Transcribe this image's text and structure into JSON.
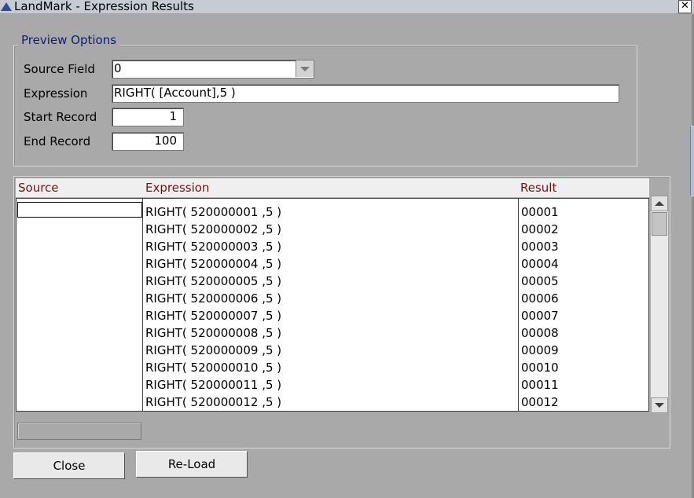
{
  "window": {
    "title": "LandMark - Expression Results",
    "close_glyph": "✕"
  },
  "preview_options": {
    "legend": "Preview Options",
    "source_field_label": "Source Field",
    "source_field_value": "0",
    "expression_label": "Expression",
    "expression_value": "RIGHT( [Account],5 )",
    "start_record_label": "Start Record",
    "start_record_value": "1",
    "end_record_label": "End Record",
    "end_record_value": "100"
  },
  "results_grid": {
    "columns": [
      "Source",
      "Expression",
      "Result"
    ],
    "rows": [
      {
        "source": "",
        "expression": "RIGHT( 520000001 ,5 )",
        "result": "00001"
      },
      {
        "source": "",
        "expression": "RIGHT( 520000002 ,5 )",
        "result": "00002"
      },
      {
        "source": "",
        "expression": "RIGHT( 520000003 ,5 )",
        "result": "00003"
      },
      {
        "source": "",
        "expression": "RIGHT( 520000004 ,5 )",
        "result": "00004"
      },
      {
        "source": "",
        "expression": "RIGHT( 520000005 ,5 )",
        "result": "00005"
      },
      {
        "source": "",
        "expression": "RIGHT( 520000006 ,5 )",
        "result": "00006"
      },
      {
        "source": "",
        "expression": "RIGHT( 520000007 ,5 )",
        "result": "00007"
      },
      {
        "source": "",
        "expression": "RIGHT( 520000008 ,5 )",
        "result": "00008"
      },
      {
        "source": "",
        "expression": "RIGHT( 520000009 ,5 )",
        "result": "00009"
      },
      {
        "source": "",
        "expression": "RIGHT( 520000010 ,5 )",
        "result": "00010"
      },
      {
        "source": "",
        "expression": "RIGHT( 520000011 ,5 )",
        "result": "00011"
      },
      {
        "source": "",
        "expression": "RIGHT( 520000012 ,5 )",
        "result": "00012"
      }
    ]
  },
  "buttons": {
    "close_label": "Close",
    "reload_label": "Re-Load"
  },
  "colors": {
    "window_bg": "#a9a9a9",
    "legend_text": "#0a1f7a",
    "column_header_text": "#7a1010",
    "title_icon": "#2a4c9a"
  },
  "icons": {
    "title_icon": "landmark-app-icon",
    "dropdown": "chevron-down-icon",
    "scroll_up": "arrow-up-icon",
    "scroll_down": "arrow-down-icon"
  }
}
